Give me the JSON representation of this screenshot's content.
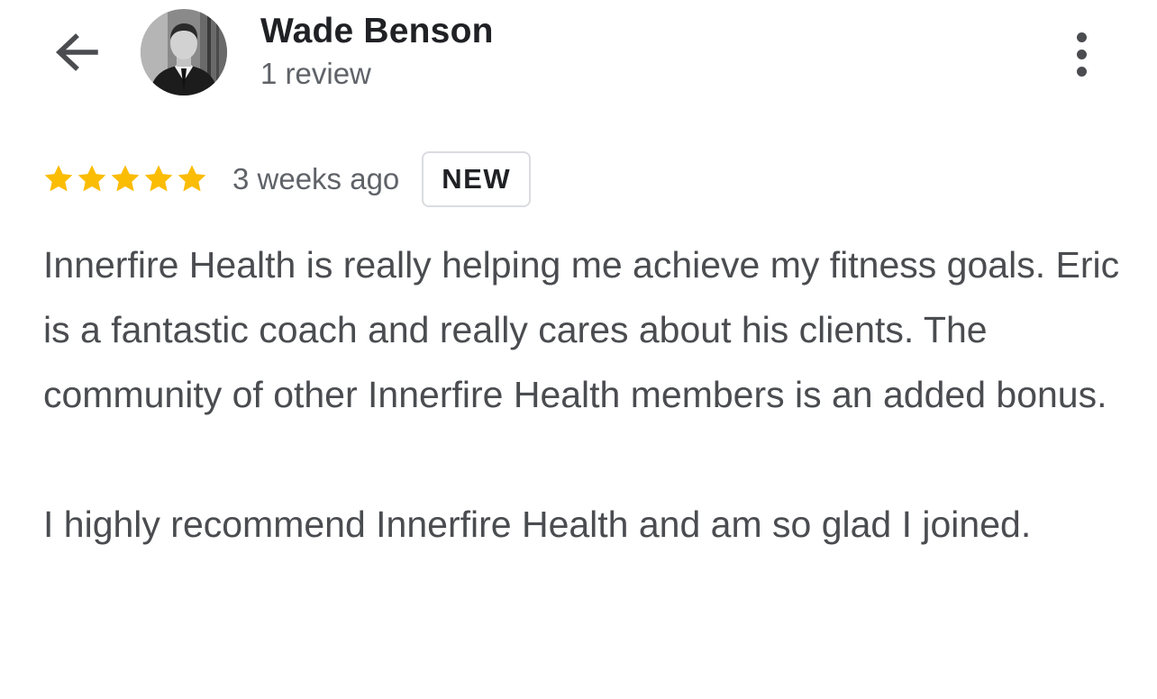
{
  "header": {
    "back_icon": "arrow-left-icon",
    "author_name": "Wade Benson",
    "review_count": "1 review",
    "more_icon": "more-vertical-icon"
  },
  "review": {
    "rating": 5,
    "max_rating": 5,
    "timestamp": "3 weeks ago",
    "badge": "NEW",
    "paragraphs": [
      "Innerfire Health is really helping me achieve my fitness goals. Eric is a fantastic coach and really cares about his clients. The community of other Innerfire Health members is an added bonus.",
      "I highly recommend Innerfire Health and am so glad I joined."
    ]
  },
  "colors": {
    "star": "#fbbc04",
    "name_text": "#202124",
    "secondary_text": "#5f6368",
    "body_text": "#4a4c50",
    "badge_border": "#dadce0"
  }
}
